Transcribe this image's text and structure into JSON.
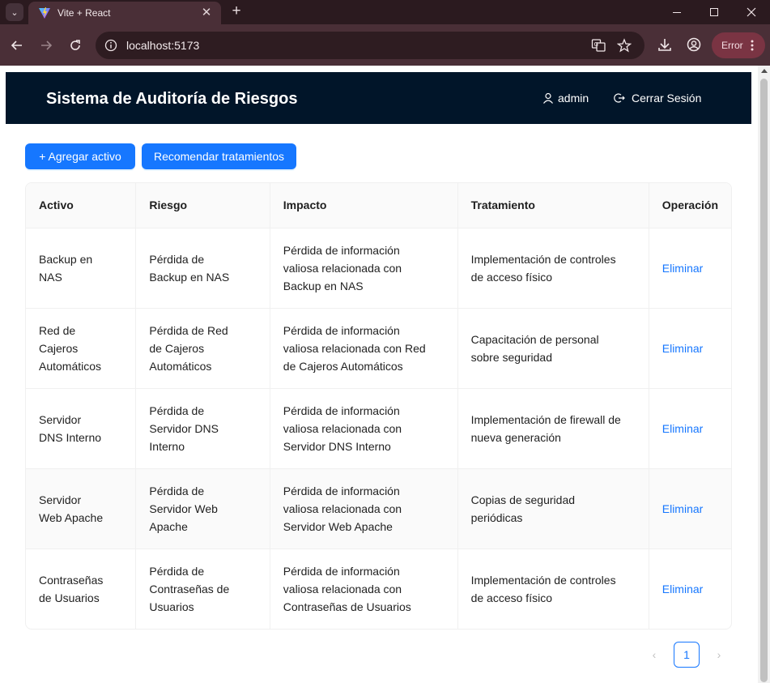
{
  "browser": {
    "tab_title": "Vite + React",
    "url": "localhost:5173",
    "profile_status": "Error"
  },
  "header": {
    "title": "Sistema de Auditoría de Riesgos",
    "user": "admin",
    "logout": "Cerrar Sesión"
  },
  "actions": {
    "add_asset": "+ Agregar activo",
    "recommend": "Recomendar tratamientos"
  },
  "table": {
    "columns": [
      "Activo",
      "Riesgo",
      "Impacto",
      "Tratamiento",
      "Operación"
    ],
    "rows": [
      {
        "activo": "Backup en NAS",
        "riesgo": "Pérdida de Backup en NAS",
        "impacto": "Pérdida de información valiosa relacionada con Backup en NAS",
        "tratamiento": "Implementación de controles de acceso físico",
        "operacion": "Eliminar"
      },
      {
        "activo": "Red de Cajeros Automáticos",
        "riesgo": "Pérdida de Red de Cajeros Automáticos",
        "impacto": "Pérdida de información valiosa relacionada con Red de Cajeros Automáticos",
        "tratamiento": "Capacitación de personal sobre seguridad",
        "operacion": "Eliminar"
      },
      {
        "activo": "Servidor DNS Interno",
        "riesgo": "Pérdida de Servidor DNS Interno",
        "impacto": "Pérdida de información valiosa relacionada con Servidor DNS Interno",
        "tratamiento": "Implementación de firewall de nueva generación",
        "operacion": "Eliminar"
      },
      {
        "activo": "Servidor Web Apache",
        "riesgo": "Pérdida de Servidor Web Apache",
        "impacto": "Pérdida de información valiosa relacionada con Servidor Web Apache",
        "tratamiento": "Copias de seguridad periódicas",
        "operacion": "Eliminar"
      },
      {
        "activo": "Contraseñas de Usuarios",
        "riesgo": "Pérdida de Contraseñas de Usuarios",
        "impacto": "Pérdida de información valiosa relacionada con Contraseñas de Usuarios",
        "tratamiento": "Implementación de controles de acceso físico",
        "operacion": "Eliminar"
      }
    ]
  },
  "pagination": {
    "current_page": "1",
    "prev": "‹",
    "next": "›"
  },
  "icons": {
    "user": "user-icon",
    "logout": "logout-icon"
  },
  "colors": {
    "header_bg": "#011529",
    "primary": "#1677ff"
  }
}
